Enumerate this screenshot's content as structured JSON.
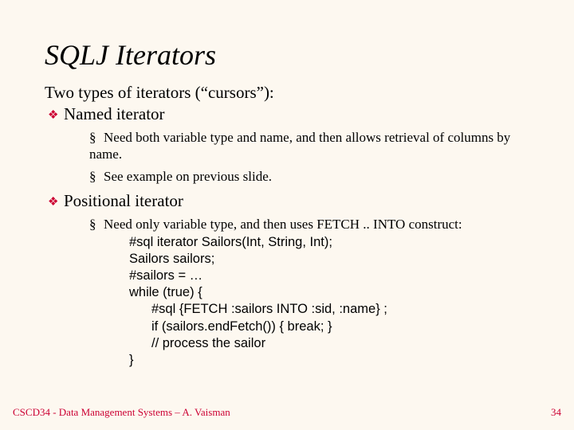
{
  "title": "SQLJ Iterators",
  "intro": "Two types of iterators (“cursors”):",
  "item1": {
    "label": "Named iterator",
    "sub1": "Need both variable type and name, and then allows retrieval of columns by name.",
    "sub2": "See example on previous slide."
  },
  "item2": {
    "label": "Positional iterator",
    "sub1": "Need only variable type, and then uses FETCH .. INTO construct:",
    "code": {
      "l1": "#sql iterator Sailors(Int, String, Int);",
      "l2": "Sailors sailors;",
      "l3": "#sailors = …",
      "l4": "while (true) {",
      "l5": "#sql {FETCH :sailors INTO :sid, :name} ;",
      "l6": "if (sailors.endFetch()) { break; }",
      "l7": "// process the sailor",
      "l8": "}"
    }
  },
  "footer": {
    "left": "CSCD34 - Data Management Systems – A. Vaisman",
    "right": "34"
  },
  "bullets": {
    "diamond": "❖",
    "square": "§"
  }
}
